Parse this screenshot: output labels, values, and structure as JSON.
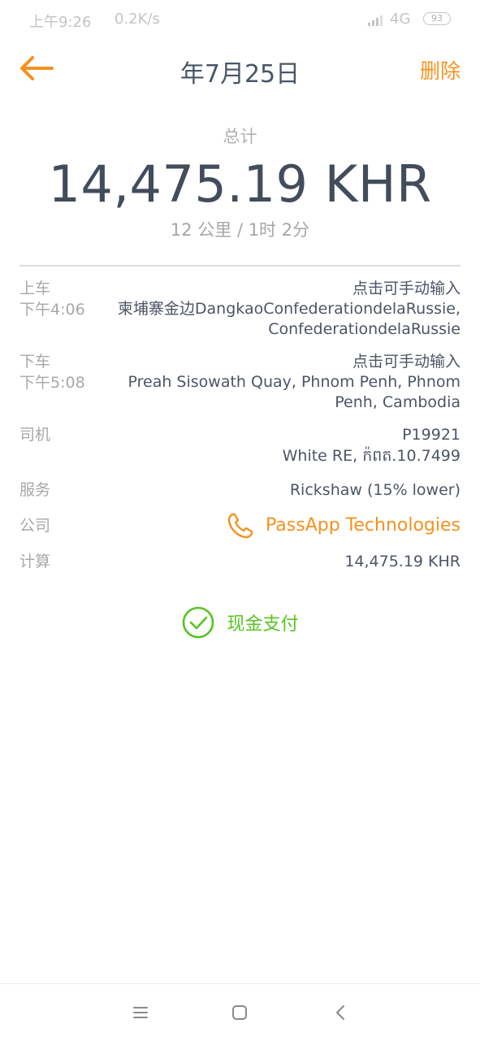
{
  "status_bar": {
    "time": "上午9:26",
    "speed": "0.2K/s",
    "network": "4G",
    "battery": "93"
  },
  "header": {
    "title": "年7月25日",
    "delete_label": "删除"
  },
  "summary": {
    "total_label": "总计",
    "total_amount": "14,475.19 KHR",
    "trip_stats": "12 公里 / 1时 2分"
  },
  "pickup": {
    "label": "上车",
    "manual_entry": "点击可手动输入",
    "time": "下午4:06",
    "address_line1": "柬埔寨金边DangkaoConfederationdelaRussie,",
    "address_line2": "ConfederationdelaRussie"
  },
  "dropoff": {
    "label": "下车",
    "manual_entry": "点击可手动输入",
    "time": "下午5:08",
    "address_line1": "Preah Sisowath Quay, Phnom Penh, Phnom",
    "address_line2": "Penh, Cambodia"
  },
  "driver": {
    "label": "司机",
    "id": "P19921",
    "vehicle": "White RE, ក៉ពត.10.7499"
  },
  "service": {
    "label": "服务",
    "value": "Rickshaw (15% lower)"
  },
  "company": {
    "label": "公司",
    "name": "PassApp Technologies"
  },
  "calculation": {
    "label": "计算",
    "value": "14,475.19 KHR"
  },
  "payment": {
    "label": "现金支付"
  },
  "icons": {
    "back": "arrow-left-icon",
    "phone": "phone-icon",
    "check": "check-circle-icon",
    "menu": "menu-icon",
    "home": "home-square-icon",
    "back_nav": "chevron-left-icon"
  },
  "colors": {
    "accent": "#f4921f",
    "success": "#58c322",
    "text_primary": "#424c5c",
    "text_secondary": "#a8a8a8"
  }
}
